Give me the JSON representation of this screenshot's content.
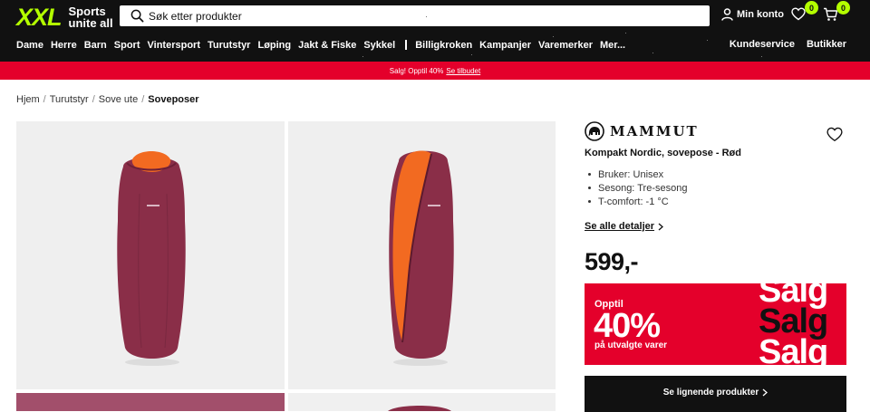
{
  "header": {
    "logo_text": "XXL",
    "logo_tagline_1": "Sports",
    "logo_tagline_2": "unite all",
    "search_placeholder": "Søk etter produkter",
    "account_label": "Min konto",
    "wishlist_count": "0",
    "cart_count": "0"
  },
  "nav": {
    "items": [
      "Dame",
      "Herre",
      "Barn",
      "Sport",
      "Vintersport",
      "Turutstyr",
      "Løping",
      "Jakt & Fiske",
      "Sykkel"
    ],
    "secondary": [
      "Billigkroken",
      "Kampanjer",
      "Varemerker",
      "Mer..."
    ],
    "right": [
      "Kundeservice",
      "Butikker"
    ]
  },
  "promo": {
    "text": "Salg! Opptil 40%",
    "link": "Se tilbudet"
  },
  "breadcrumb": [
    "Hjem",
    "Turutstyr",
    "Sove ute",
    "Soveposer"
  ],
  "product": {
    "brand": "MAMMUT",
    "title": "Kompakt Nordic, sovepose - Rød",
    "specs": [
      "Bruker: Unisex",
      "Sesong: Tre-sesong",
      "T-comfort: -1 °C"
    ],
    "details_link": "Se alle detaljer",
    "price": "599,-"
  },
  "sale_banner": {
    "upto": "Opptil",
    "percent": "40%",
    "sub": "på utvalgte varer",
    "word": "Salg"
  },
  "similar_button": "Se lignende produkter",
  "colors": {
    "accent_green": "#b4ff00",
    "sale_red": "#e4002b",
    "bag_plum": "#8a2e48",
    "bag_lining": "#f26a21"
  }
}
